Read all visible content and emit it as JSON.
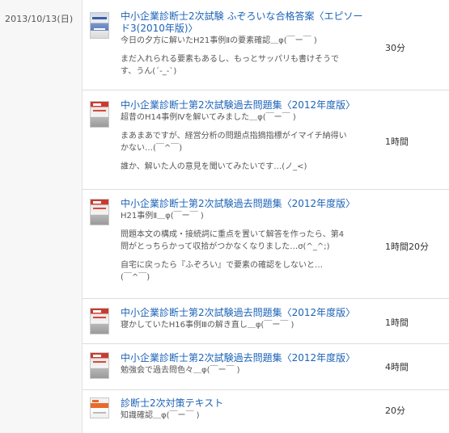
{
  "date": "2013/10/13(日)",
  "entries": [
    {
      "title_line1": "中小企業診断士2次試験 ふぞろいな合格答案〈エピソー",
      "title_line2": "ド3(2010年版)〉",
      "comments": [
        "今日の夕方に解いたH21事例Ⅱの要素確認＿φ(￣ー￣ )",
        "まだ入れられる要素もあるし、もっとサッパリも書けそうで",
        "す、うん(´-_-`)"
      ],
      "time": "30分",
      "thumb_icon": "book-cover-fuzoroi-icon"
    },
    {
      "title_line1": "中小企業診断士第2次試験過去問題集〈2012年度版〉",
      "comments": [
        "超昔のH14事例Ⅳを解いてみました＿φ(￣ー￣ )",
        "まあまあですが、経営分析の問題点指摘指標がイマイチ納得い",
        "かない…(￣^￣)",
        "誰か、解いた人の意見を聞いてみたいです…(ノ_<)"
      ],
      "time": "1時間",
      "thumb_icon": "book-cover-kakomon-icon"
    },
    {
      "title_line1": "中小企業診断士第2次試験過去問題集〈2012年度版〉",
      "comments": [
        "H21事例Ⅱ＿φ(￣ー￣ )",
        "問題本文の構成・接続詞に重点を置いて解答を作ったら、第4",
        "問がとっちらかって収拾がつかなくなりました…σ(^_^;)",
        "自宅に戻ったら『ふぞろい』で要素の確認をしないと…",
        "(￣^￣)"
      ],
      "time": "1時間20分",
      "thumb_icon": "book-cover-kakomon-icon"
    },
    {
      "title_line1": "中小企業診断士第2次試験過去問題集〈2012年度版〉",
      "comments": [
        "寝かしていたH16事例Ⅲの解き直し＿φ(￣ー￣ )"
      ],
      "time": "1時間",
      "thumb_icon": "book-cover-kakomon-icon"
    },
    {
      "title_line1": "中小企業診断士第2次試験過去問題集〈2012年度版〉",
      "comments": [
        "勉強会で過去問色々＿φ(￣ー￣ )"
      ],
      "time": "4時間",
      "thumb_icon": "book-cover-kakomon-icon"
    },
    {
      "title_line1": "診断士2次対策テキスト",
      "comments": [
        "知識確認＿φ(￣ー￣ )"
      ],
      "time": "20分",
      "thumb_icon": "book-cover-text-icon"
    }
  ]
}
